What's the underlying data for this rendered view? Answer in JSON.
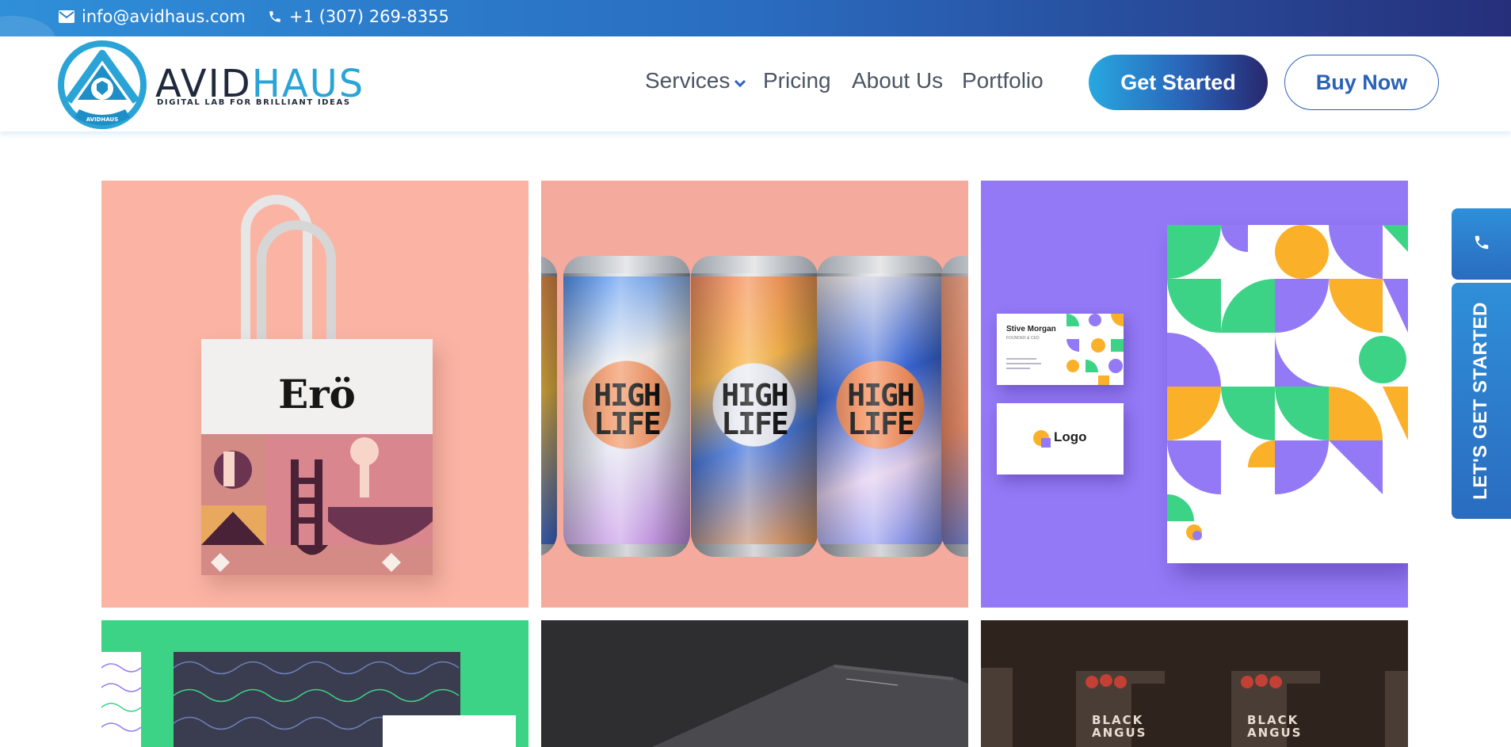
{
  "topbar": {
    "email": "info@avidhaus.com",
    "phone": "+1 (307) 269-8355",
    "icons": [
      "envelope-icon",
      "phone-icon"
    ]
  },
  "brand": {
    "word_part1": "AVID",
    "word_part2": "HAUS",
    "tagline": "DIGITAL LAB FOR BRILLIANT IDEAS",
    "badge_text": "AVIDHAUS",
    "colors": {
      "dark": "#1f2a3c",
      "accent": "#2aa4d6"
    }
  },
  "nav": {
    "items": [
      {
        "label": "Services",
        "has_dropdown": true
      },
      {
        "label": "Pricing"
      },
      {
        "label": "About Us"
      },
      {
        "label": "Portfolio"
      }
    ]
  },
  "actions": {
    "get_started": "Get Started",
    "buy_now": "Buy Now"
  },
  "portfolio": {
    "tiles": [
      {
        "subject": "tote-bag",
        "text": "Erö",
        "bg": "#fbb4a4"
      },
      {
        "subject": "cans",
        "text": "HIGH LIFE",
        "bg": "#f4aa9c"
      },
      {
        "subject": "stationery",
        "bg": "#9479f6",
        "card_name": "Stive Morgan",
        "card_role": "FOUNDER & CEO",
        "logo_text": "Logo"
      },
      {
        "subject": "pattern-print",
        "bg": "#3dd386"
      },
      {
        "subject": "dark-paper",
        "bg": "#2e2e30"
      },
      {
        "subject": "packaging",
        "text": "BLACK ANGUS",
        "bg": "#2f231d"
      }
    ]
  },
  "side_widget": {
    "call_icon": "phone-icon",
    "cta_label": "LET'S GET STARTED"
  }
}
